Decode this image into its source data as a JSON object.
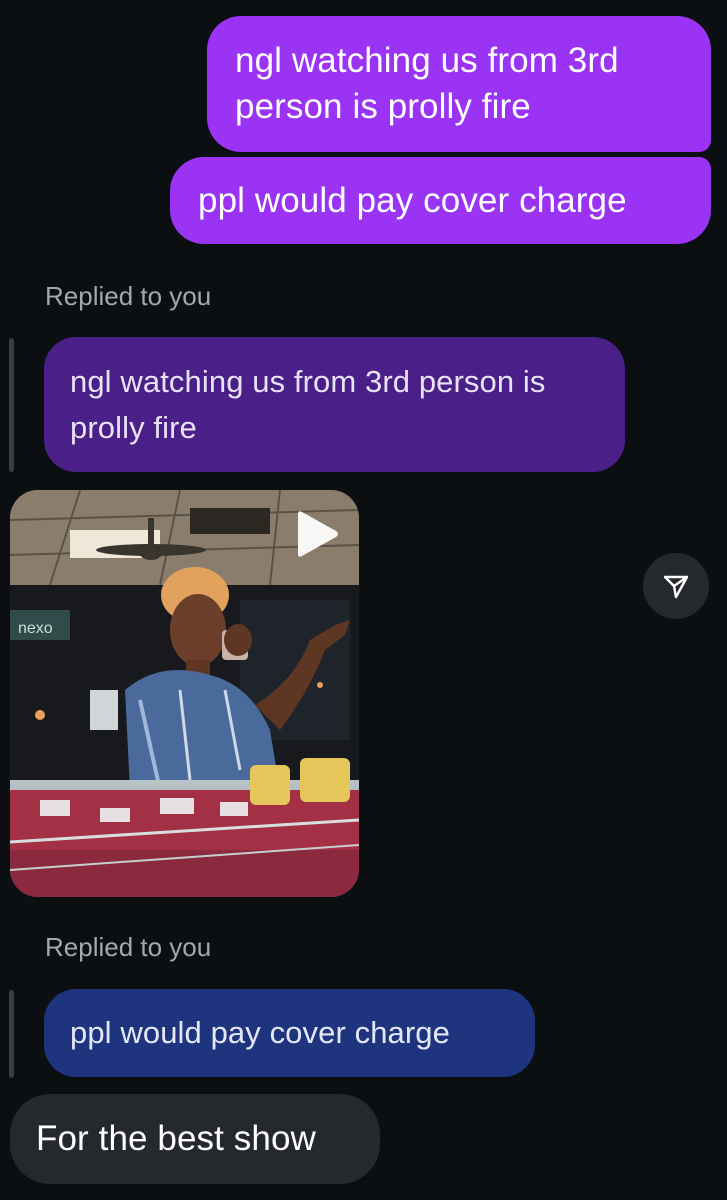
{
  "thread": {
    "sent_messages": [
      "ngl watching us from 3rd person is prolly fire",
      "ppl would pay cover charge"
    ],
    "replies": [
      {
        "label": "Replied to you",
        "quoted_text": "ngl watching us from 3rd person is prolly fire",
        "attachment": {
          "type": "video",
          "icon": "play-icon"
        }
      },
      {
        "label": "Replied to you",
        "quoted_text": "ppl would pay cover charge"
      }
    ],
    "received_messages": [
      "For the best show"
    ],
    "share_icon": "send-icon"
  },
  "colors": {
    "background": "#0b0f12",
    "sent_bubble": "#9a33f4",
    "quoted_bubble_1": "#4a1f88",
    "quoted_bubble_2": "#1f347f",
    "received_bubble": "#25282c",
    "muted_text": "#a4a7ab"
  }
}
